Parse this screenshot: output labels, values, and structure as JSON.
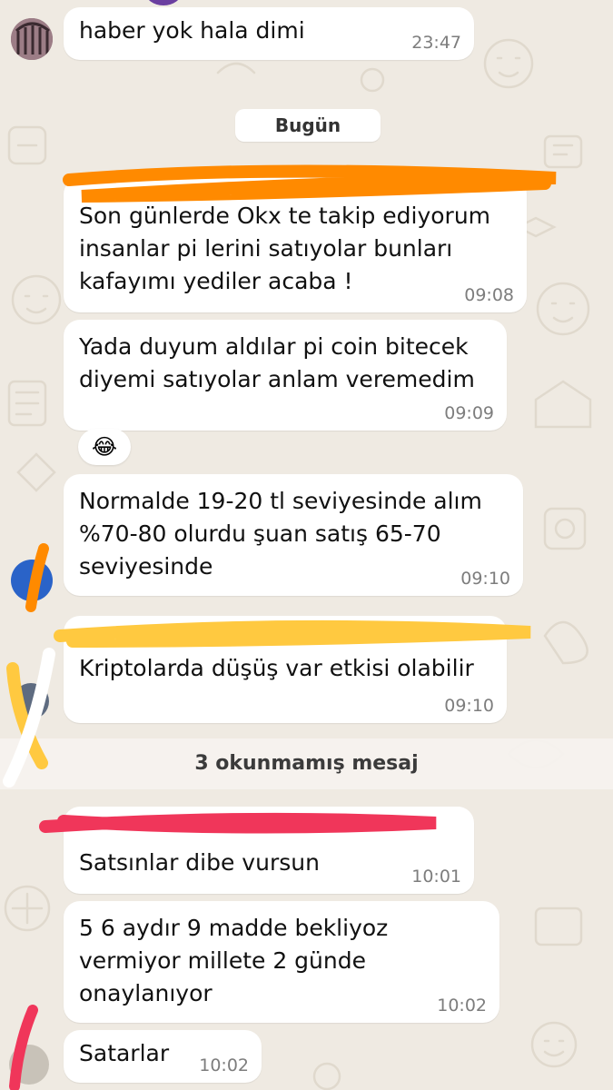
{
  "date_separator": "Bugün",
  "unread_banner": "3 okunmamış mesaj",
  "messages": [
    {
      "text": "haber yok hala dimi",
      "time": "23:47"
    },
    {
      "text": "Son günlerde Okx te takip ediyorum\ninsanlar pi lerini satıyolar bunları\nkafayımı yediler acaba !",
      "time": "09:08"
    },
    {
      "text": "Yada duyum aldılar pi coin bitecek\ndiyemi satıyolar anlam veremedim",
      "time": "09:09"
    },
    {
      "text": "Normalde 19-20 tl seviyesinde alım\n%70-80 olurdu şuan satış 65-70\nseviyesinde",
      "time": "09:10"
    },
    {
      "text": "Kriptolarda düşüş var etkisi olabilir",
      "time": "09:10"
    },
    {
      "text": "Satsınlar dibe vursun",
      "time": "10:01"
    },
    {
      "text": "5 6 aydır 9 madde bekliyoz\nvermiyor millete 2 günde\nonaylanıyor",
      "time": "10:02"
    },
    {
      "text": "Satarlar",
      "time": "10:02"
    }
  ],
  "reaction": {
    "emoji": "😂",
    "icon": "face-with-tears-of-joy-icon"
  },
  "colors": {
    "wallpaper": "#efeae2",
    "bubble": "#ffffff",
    "scribble_orange": "#ff8a00",
    "scribble_yellow": "#ffc940",
    "scribble_red": "#f0365a",
    "avatar_blue": "#2a63c8"
  }
}
